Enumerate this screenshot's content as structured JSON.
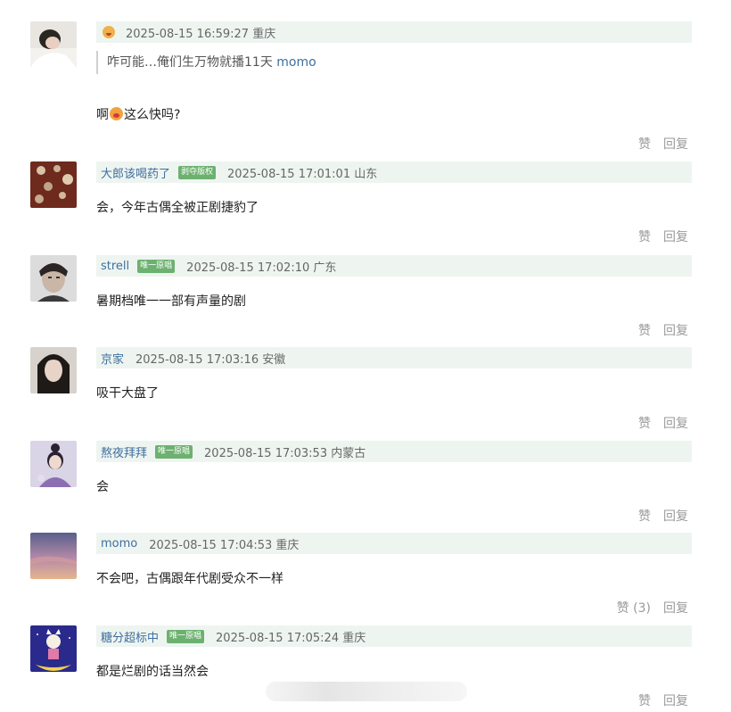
{
  "comments": [
    {
      "name": "",
      "badge": "",
      "meta": "2025-08-15 16:59:27 重庆",
      "quote": {
        "text": "咋可能…俺们生万物就播11天 ",
        "author": "momo"
      },
      "content_before": "啊",
      "content_after": "这么快吗?",
      "like": "赞",
      "reply": "回复"
    },
    {
      "name": "大郎该喝药了",
      "badge": "剥夺版权",
      "meta": "2025-08-15 17:01:01 山东",
      "content": "会，今年古偶全被正剧捷豹了",
      "like": "赞",
      "reply": "回复"
    },
    {
      "name": "strell",
      "badge": "唯一原唱",
      "meta": "2025-08-15 17:02:10 广东",
      "content": "暑期档唯一一部有声量的剧",
      "like": "赞",
      "reply": "回复"
    },
    {
      "name": "京家",
      "badge": "",
      "meta": "2025-08-15 17:03:16 安徽",
      "content": "吸干大盘了",
      "like": "赞",
      "reply": "回复"
    },
    {
      "name": "熬夜拜拜",
      "badge": "唯一原唱",
      "meta": "2025-08-15 17:03:53 内蒙古",
      "content": "会",
      "like": "赞",
      "reply": "回复"
    },
    {
      "name": "momo",
      "badge": "",
      "meta": "2025-08-15 17:04:53 重庆",
      "content": "不会吧，古偶跟年代剧受众不一样",
      "like": "赞 (3)",
      "reply": "回复"
    },
    {
      "name": "糖分超标中",
      "badge": "唯一原唱",
      "meta": "2025-08-15 17:05:24 重庆",
      "content": "都是烂剧的话当然会",
      "like": "赞",
      "reply": "回复"
    }
  ],
  "colors": {
    "header_bg": "#eef5f1",
    "username": "#3f6f9f",
    "badge_bg": "#6cb16f",
    "action_text": "#9a9a9a"
  }
}
